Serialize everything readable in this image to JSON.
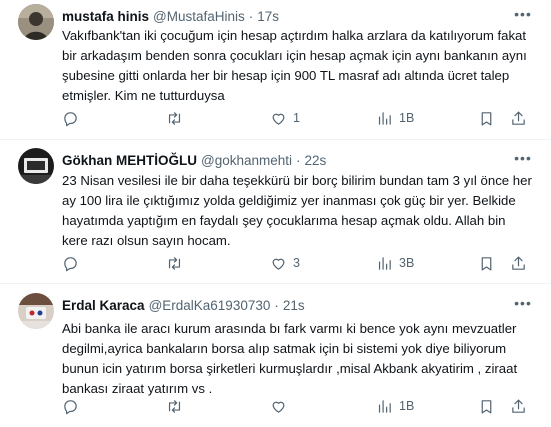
{
  "tweets": [
    {
      "name": "mustafa hinis",
      "handle": "@MustafaHinis",
      "time": "17s",
      "text": "Vakıfbank'tan iki çocuğum için hesap açtırdım halka arzlara da katılıyorum fakat bir arkadaşım benden sonra çocukları için hesap açmak için aynı bankanın aynı şubesine gitti onlarda her bir hesap için 900 TL masraf adı altında ücret talep etmişler. Kim ne tutturduysa",
      "replies": "",
      "retweets": "",
      "likes": "1",
      "views": "1B"
    },
    {
      "name": "Gökhan MEHTİOĞLU",
      "handle": "@gokhanmehti",
      "time": "22s",
      "text": "23 Nisan vesilesi ile bir daha teşekkürü bir borç bilirim bundan tam 3 yıl önce her ay 100 lira ile çıktığımız yolda geldiğimiz yer inanması çok güç bir yer. Belkide hayatımda yaptığım en faydalı şey çocuklarıma hesap açmak oldu. Allah bin kere razı olsun sayın hocam.",
      "replies": "",
      "retweets": "",
      "likes": "3",
      "views": "3B"
    },
    {
      "name": "Erdal Karaca",
      "handle": "@ErdalKa61930730",
      "time": "21s",
      "text": "Abi banka ile aracı kurum arasında bı fark varmı ki bence yok aynı mevzuatler degilmi,ayrica bankaların borsa alıp satmak için bi sistemi yok diye biliyorum bunun icin yatırım borsa şirketleri kurmuşlardır ,misal Akbank akyatirim , ziraat bankası ziraat yatırım vs .",
      "replies": "",
      "retweets": "",
      "likes": "",
      "views": "1B"
    }
  ],
  "colors": {
    "text": "#0f1419",
    "secondary": "#536471",
    "divider": "#eff3f4"
  },
  "icons": [
    "more-icon",
    "reply-icon",
    "retweet-icon",
    "like-icon",
    "views-icon",
    "bookmark-icon",
    "share-icon"
  ]
}
